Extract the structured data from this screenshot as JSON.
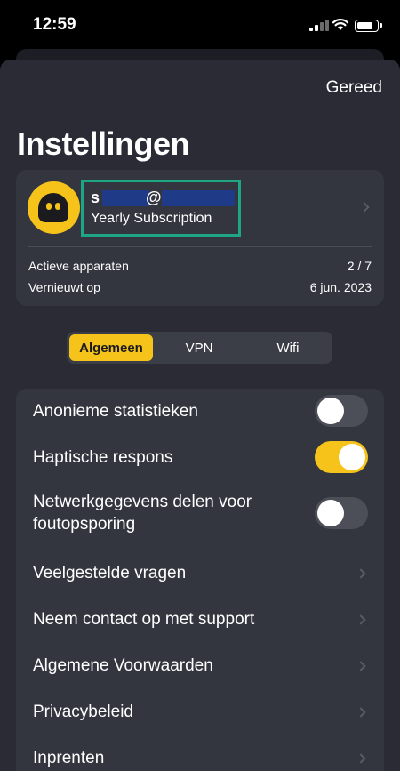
{
  "status_bar": {
    "time": "12:59"
  },
  "header": {
    "done_label": "Gereed",
    "title": "Instellingen"
  },
  "account": {
    "email_first": "s",
    "email_at": "@",
    "plan": "Yearly Subscription",
    "stats": [
      {
        "label": "Actieve apparaten",
        "value": "2 / 7"
      },
      {
        "label": "Vernieuwt op",
        "value": "6 jun. 2023"
      }
    ]
  },
  "tabs": [
    {
      "label": "Algemeen",
      "active": true
    },
    {
      "label": "VPN",
      "active": false
    },
    {
      "label": "Wifi",
      "active": false
    }
  ],
  "settings": [
    {
      "label": "Anonieme statistieken",
      "type": "toggle",
      "on": false
    },
    {
      "label": "Haptische respons",
      "type": "toggle",
      "on": true
    },
    {
      "label": "Netwerkgegevens delen voor foutopsporing",
      "type": "toggle",
      "on": false
    },
    {
      "label": "Veelgestelde vragen",
      "type": "link"
    },
    {
      "label": "Neem contact op met support",
      "type": "link"
    },
    {
      "label": "Algemene Voorwaarden",
      "type": "link"
    },
    {
      "label": "Privacybeleid",
      "type": "link"
    },
    {
      "label": "Inprenten",
      "type": "link"
    }
  ],
  "colors": {
    "accent": "#f6c31b",
    "sheet_background": "#2a2b34",
    "card_background": "#33353f",
    "highlight_border": "#1ea585",
    "redaction": "#1f3a86"
  }
}
